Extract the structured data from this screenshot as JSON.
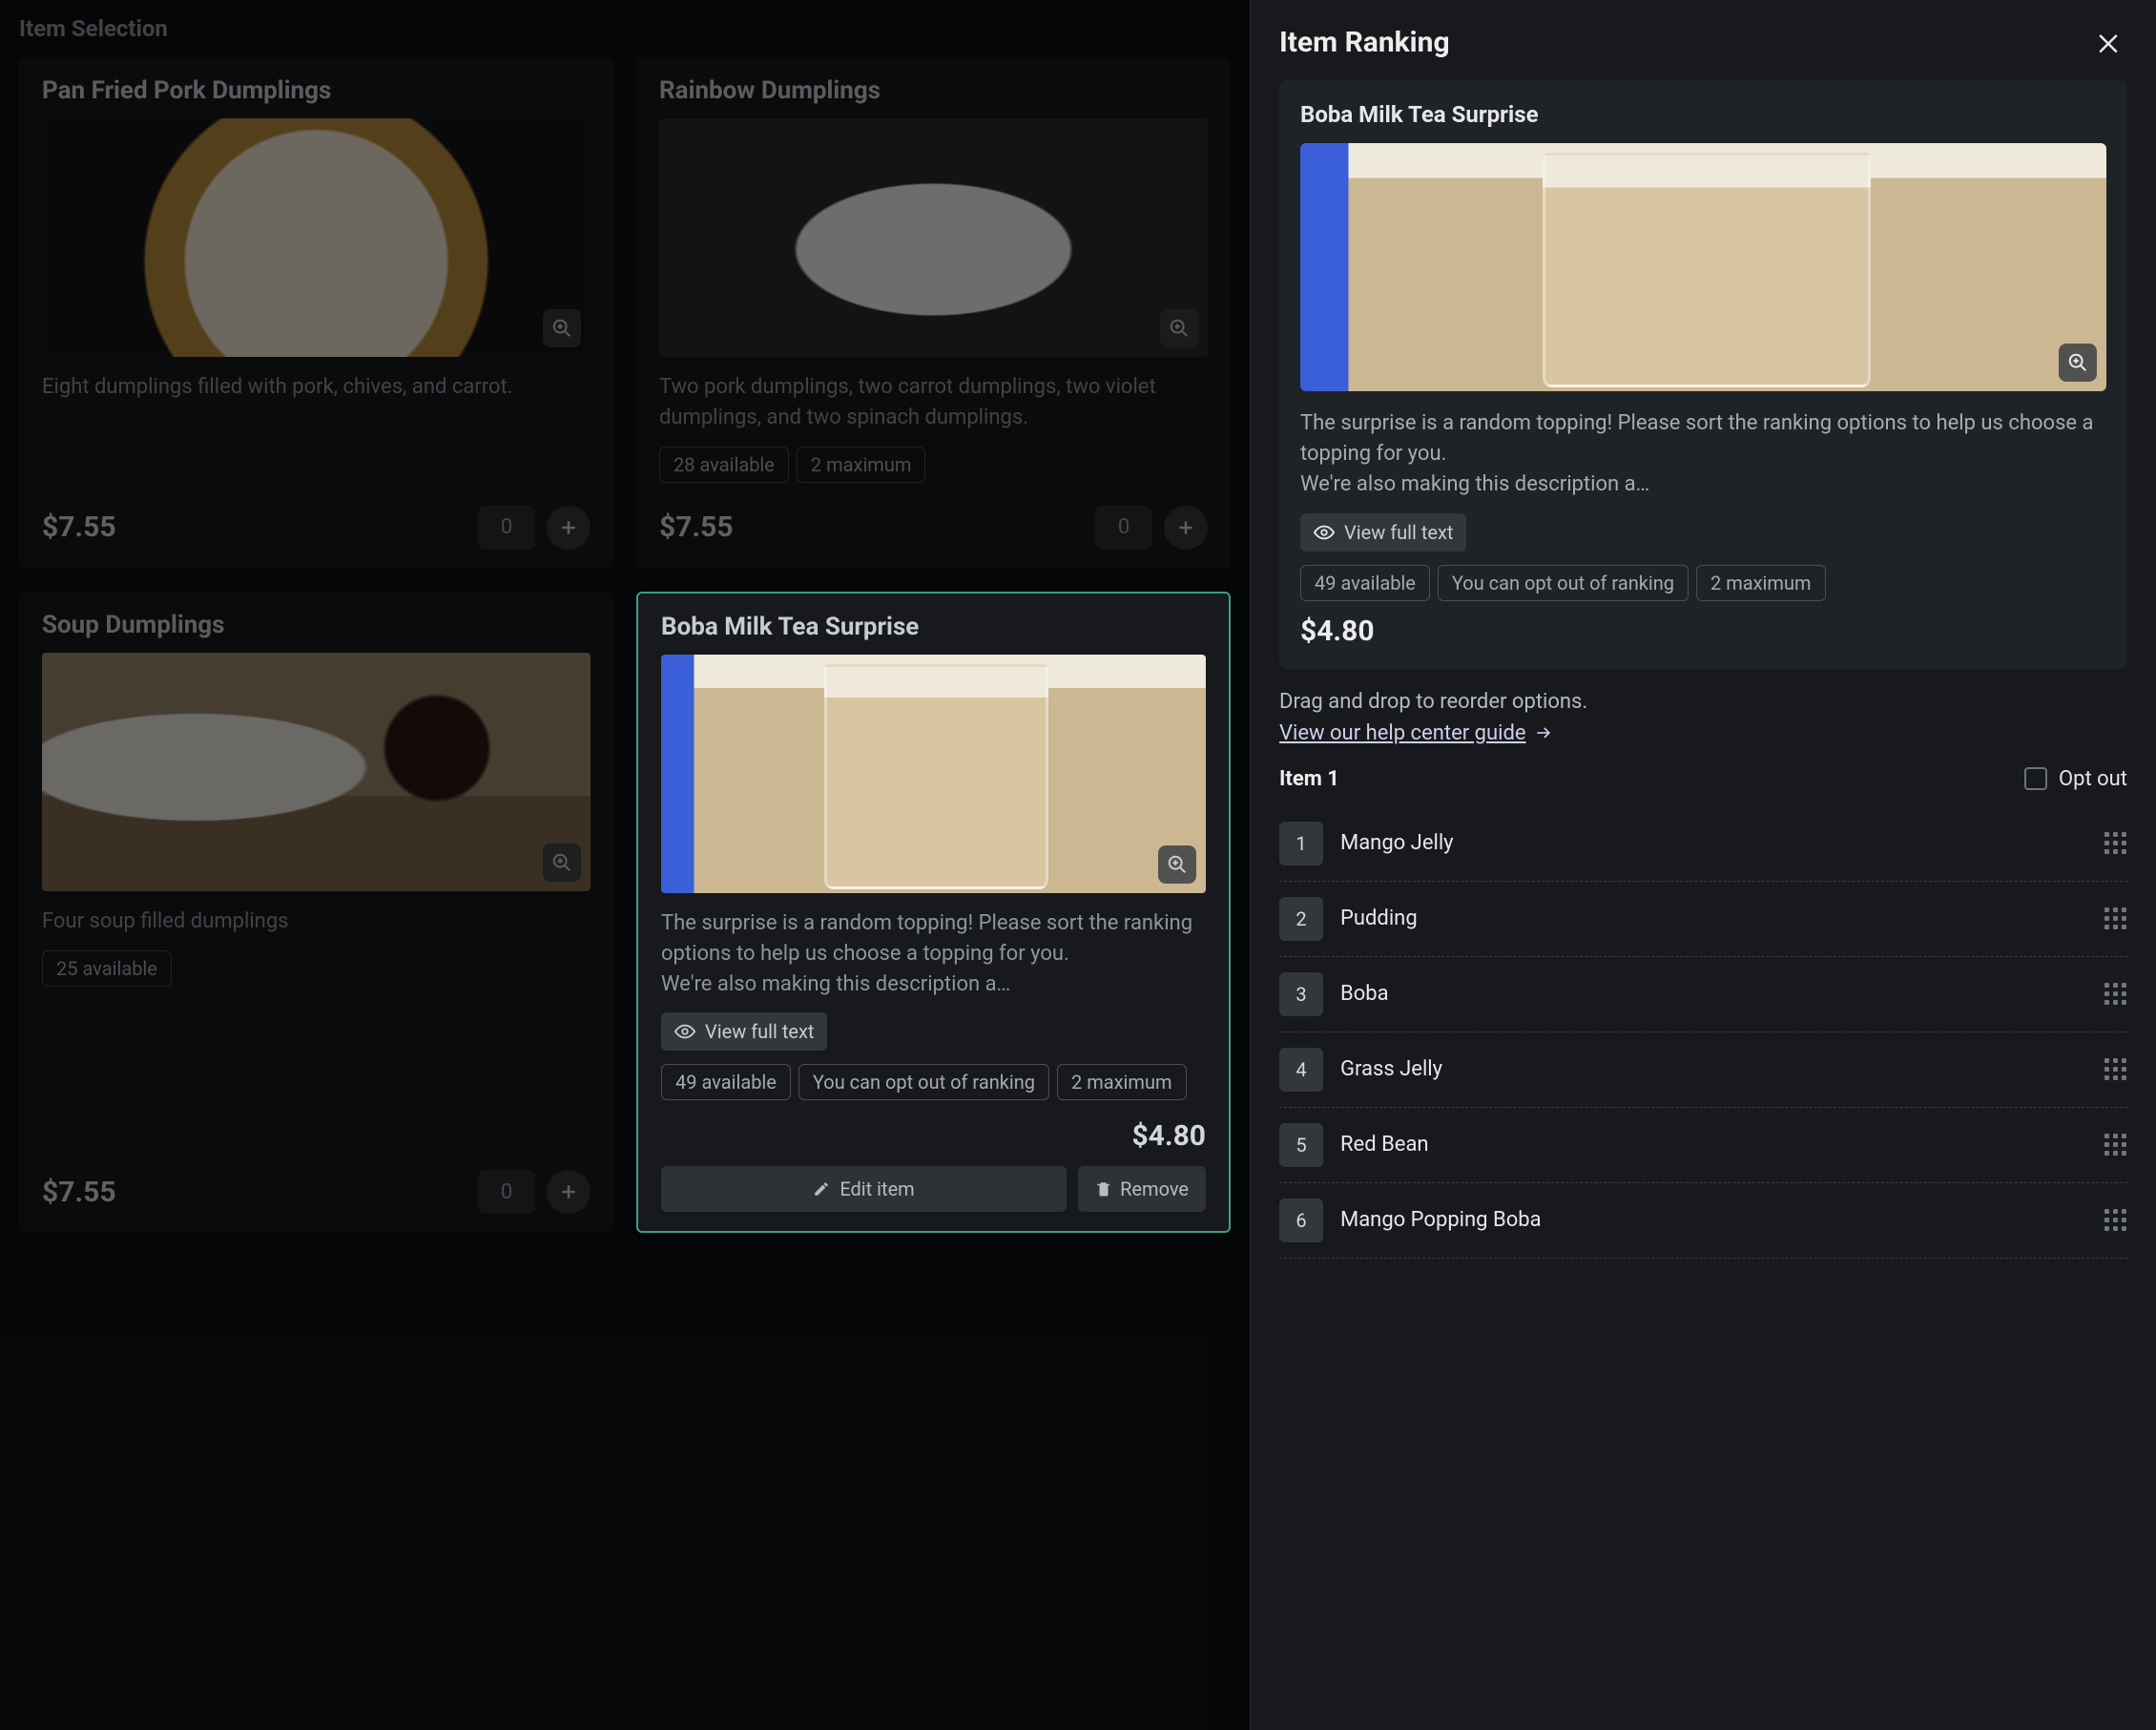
{
  "section_title": "Item Selection",
  "cards": {
    "pork": {
      "title": "Pan Fried Pork Dumplings",
      "desc": "Eight dumplings filled with pork, chives, and carrot.",
      "price": "$7.55",
      "qty": "0"
    },
    "rainbow": {
      "title": "Rainbow Dumplings",
      "desc": "Two pork dumplings, two carrot dumplings, two violet dumplings, and two spinach dumplings.",
      "available": "28 available",
      "max": "2 maximum",
      "price": "$7.55",
      "qty": "0"
    },
    "soup": {
      "title": "Soup Dumplings",
      "desc": "Four soup filled dumplings",
      "available": "25 available",
      "price": "$7.55",
      "qty": "0"
    },
    "boba": {
      "title": "Boba Milk Tea Surprise",
      "desc": "The surprise is a random topping! Please sort the ranking options to help us choose a topping for you.\nWe're also making this description a…",
      "view_full": "View full text",
      "available": "49 available",
      "optout_chip": "You can opt out of ranking",
      "max": "2 maximum",
      "price": "$4.80",
      "edit": "Edit item",
      "remove": "Remove"
    }
  },
  "panel": {
    "title": "Item Ranking",
    "detail": {
      "title": "Boba Milk Tea Surprise",
      "desc": "The surprise is a random topping! Please sort the ranking options to help us choose a topping for you.\nWe're also making this description a…",
      "view_full": "View full text",
      "available": "49 available",
      "optout_chip": "You can opt out of ranking",
      "max": "2 maximum",
      "price": "$4.80"
    },
    "hint": "Drag and drop to reorder options.",
    "guide": "View our help center guide",
    "item_label": "Item 1",
    "optout_label": "Opt out",
    "options": [
      {
        "n": "1",
        "label": "Mango Jelly"
      },
      {
        "n": "2",
        "label": "Pudding"
      },
      {
        "n": "3",
        "label": "Boba"
      },
      {
        "n": "4",
        "label": "Grass Jelly"
      },
      {
        "n": "5",
        "label": "Red Bean"
      },
      {
        "n": "6",
        "label": "Mango Popping Boba"
      }
    ]
  }
}
